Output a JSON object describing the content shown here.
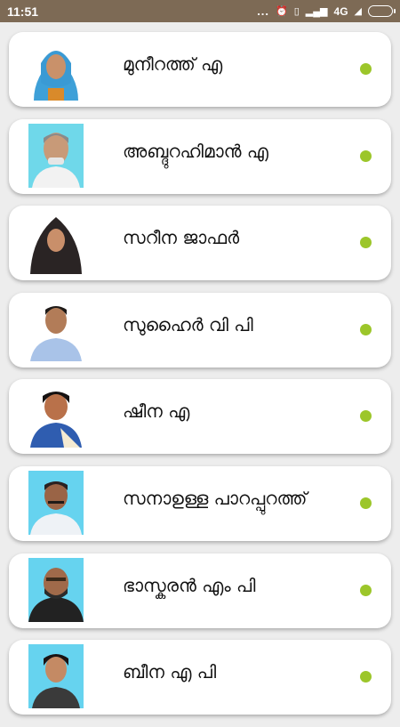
{
  "status_bar": {
    "time": "11:51",
    "dots": "...",
    "network": "4G",
    "icons": [
      "alarm-icon",
      "vibrate-icon",
      "signal-icon",
      "no-signal-icon",
      "battery-icon"
    ]
  },
  "members": [
    {
      "name": "മുനീറത്ത് എ",
      "online": true,
      "photo_bg": "#4aa6d8"
    },
    {
      "name": "അബ്ദുറഹിമാൻ എ",
      "online": true,
      "photo_bg": "#6fd8ea"
    },
    {
      "name": "സറീന ജാഫർ",
      "online": true,
      "photo_bg": "#ffffff"
    },
    {
      "name": "സുഹൈർ വി പി",
      "online": true,
      "photo_bg": "#ffffff"
    },
    {
      "name": "ഷീന എ",
      "online": true,
      "photo_bg": "#ffffff"
    },
    {
      "name": "സനാഉള്ള പാറപ്പുറത്ത്",
      "online": true,
      "photo_bg": "#66d3ef"
    },
    {
      "name": "ഭാസ്കരൻ എം പി",
      "online": true,
      "photo_bg": "#66d3ef"
    },
    {
      "name": "ബീന എ പി",
      "online": true,
      "photo_bg": "#66d3ef"
    }
  ],
  "colors": {
    "status_bar": "#7d6a55",
    "online_dot": "#9cc62a",
    "background": "#ededed"
  }
}
